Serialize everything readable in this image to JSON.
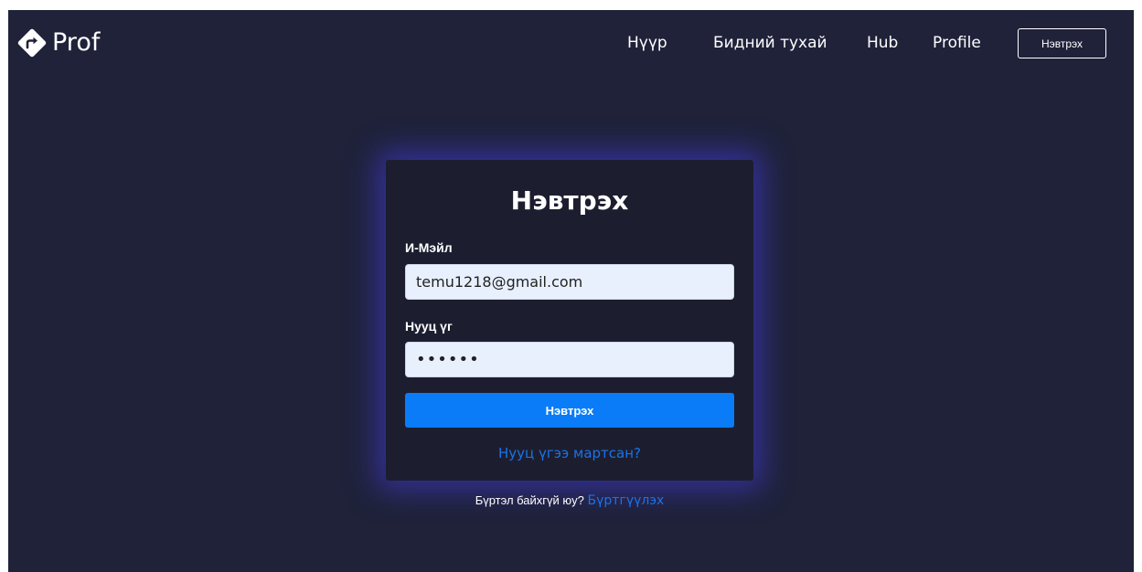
{
  "navbar": {
    "brand": "Prof",
    "brand_icon": "diamond-arrow-icon",
    "links": [
      "Нүүр",
      "Бидний тухай",
      "Hub",
      "Profile"
    ],
    "login_button": "Нэвтрэх"
  },
  "login_form": {
    "title": "Нэвтрэх",
    "email_label": "И-Мэйл",
    "email_value": "temu1218@gmail.com",
    "password_label": "Нууц үг",
    "password_value": "••••••",
    "submit_label": "Нэвтрэх",
    "forgot_link": "Нууц үгээ мартсан?"
  },
  "signup": {
    "prompt": "Бүртэл байхгүй юу?",
    "link": "Бүртгүүлэх"
  },
  "colors": {
    "page_background": "#1f2239",
    "card_background": "#1c1e30",
    "primary_button": "#0a7cf8",
    "link": "#1a73e8",
    "input_background": "#e8f0fe",
    "card_glow": "#463ce6"
  }
}
